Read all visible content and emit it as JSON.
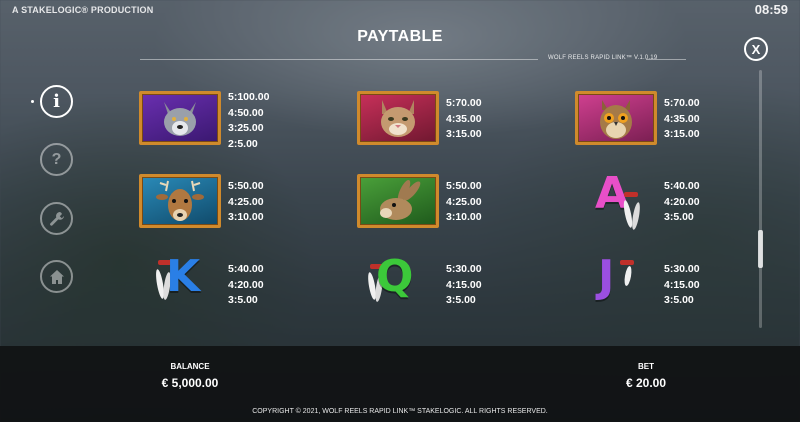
{
  "header": {
    "brand": "A STAKELOGIC® PRODUCTION",
    "clock": "08:59",
    "title": "PAYTABLE",
    "version": "WOLF REELS RAPID LINK™ V.1.0.19",
    "close_label": "X"
  },
  "sidebar": {
    "info_label": "i",
    "help_label": "?"
  },
  "symbols": [
    {
      "name": "wolf",
      "pays": [
        "5:100.00",
        "4:50.00",
        "3:25.00",
        "2:5.00"
      ]
    },
    {
      "name": "lynx",
      "pays": [
        "5:70.00",
        "4:35.00",
        "3:15.00"
      ]
    },
    {
      "name": "owl",
      "pays": [
        "5:70.00",
        "4:35.00",
        "3:15.00"
      ]
    },
    {
      "name": "deer",
      "pays": [
        "5:50.00",
        "4:25.00",
        "3:10.00"
      ]
    },
    {
      "name": "hare",
      "pays": [
        "5:50.00",
        "4:25.00",
        "3:10.00"
      ]
    },
    {
      "name": "A",
      "letter": "A",
      "color": "#e84fc8",
      "pays": [
        "5:40.00",
        "4:20.00",
        "3:5.00"
      ]
    },
    {
      "name": "K",
      "letter": "K",
      "color": "#2a7fe6",
      "pays": [
        "5:40.00",
        "4:20.00",
        "3:5.00"
      ]
    },
    {
      "name": "Q",
      "letter": "Q",
      "color": "#3cc83a",
      "pays": [
        "5:30.00",
        "4:15.00",
        "3:5.00"
      ]
    },
    {
      "name": "J",
      "letter": "J",
      "color": "#9b4fe0",
      "pays": [
        "5:30.00",
        "4:15.00",
        "3:5.00"
      ]
    }
  ],
  "footer": {
    "balance_label": "BALANCE",
    "balance_value": "€ 5,000.00",
    "bet_label": "BET",
    "bet_value": "€ 20.00",
    "copyright": "COPYRIGHT © 2021, WOLF REELS RAPID LINK™ STAKELOGIC. ALL RIGHTS RESERVED."
  },
  "colors": {
    "tile_border": "#d08a2c",
    "bottom_bar": "#101214"
  }
}
